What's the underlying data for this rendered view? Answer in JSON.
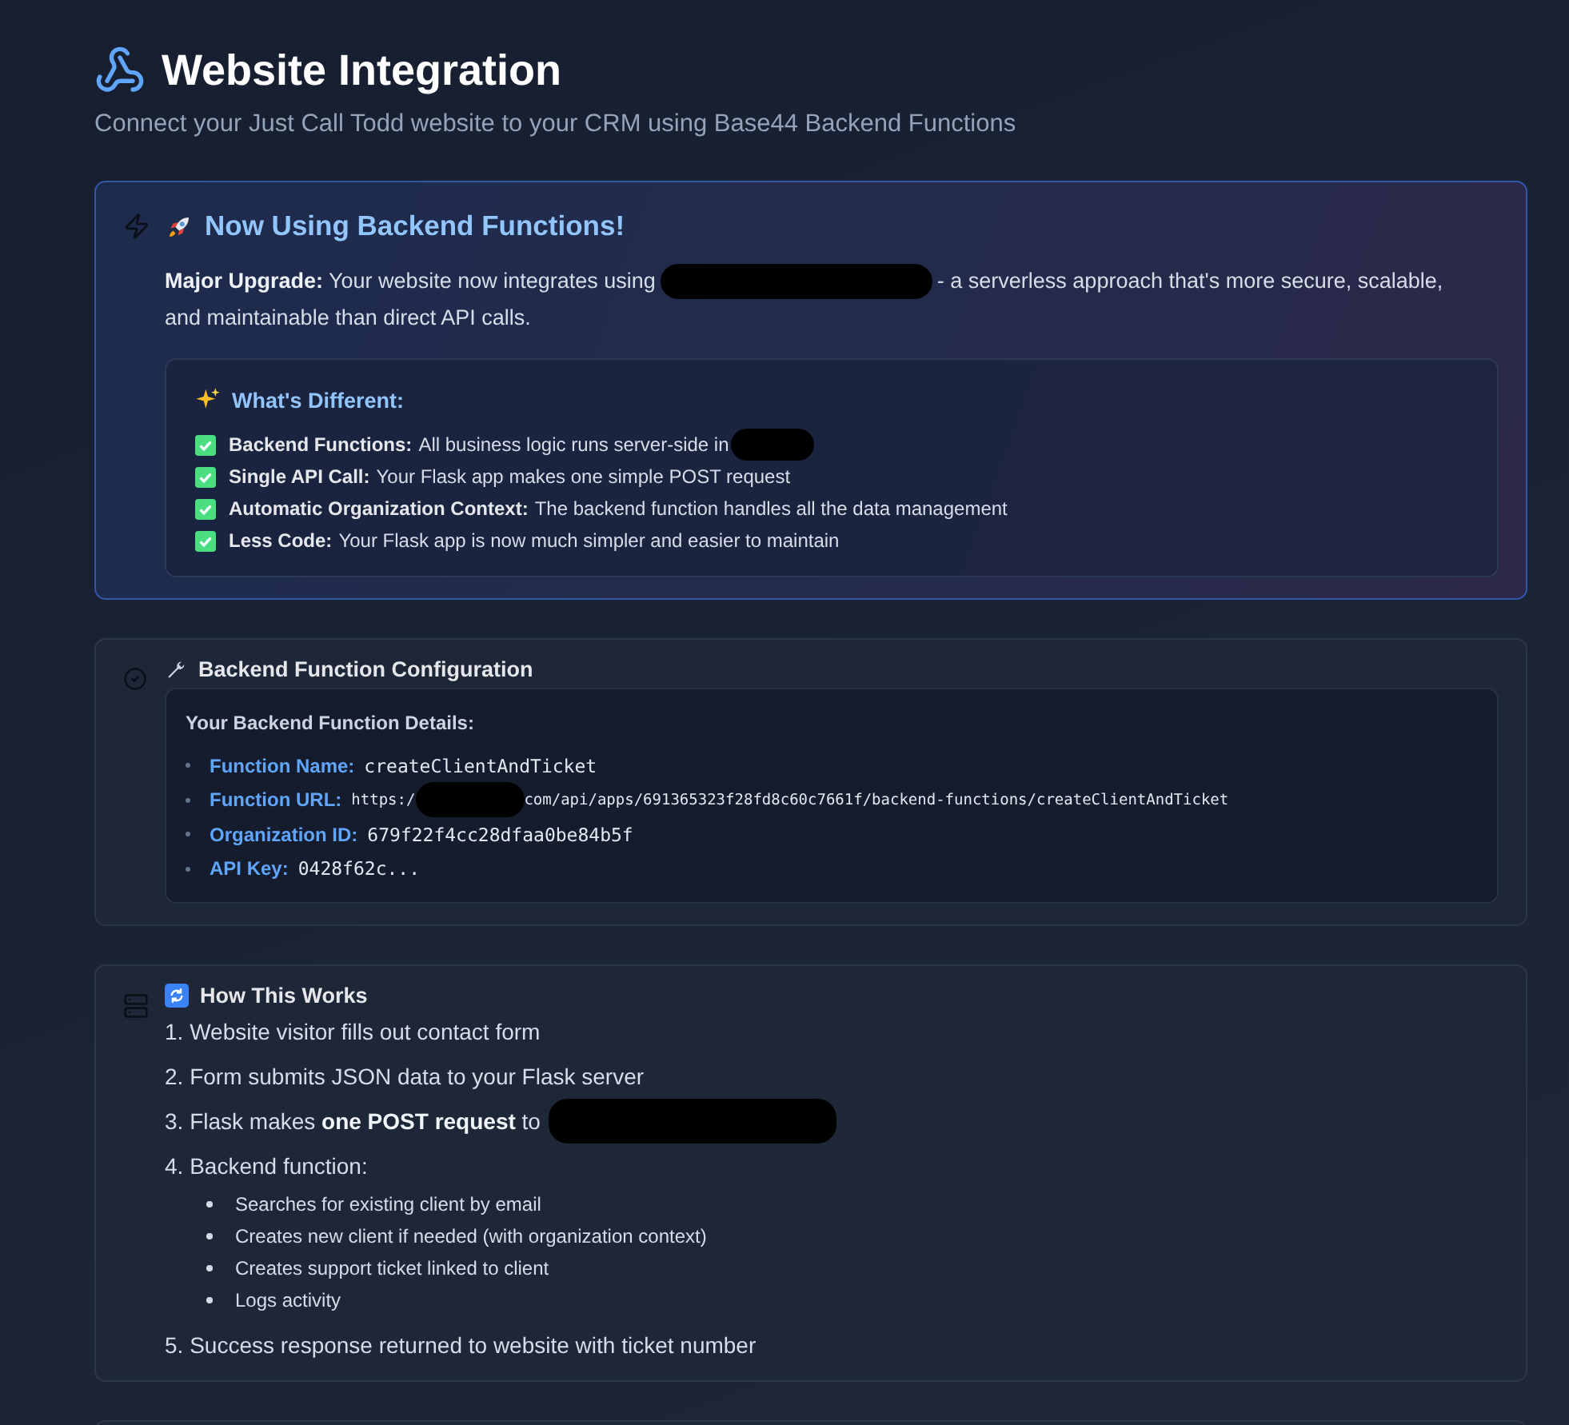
{
  "header": {
    "title": "Website Integration",
    "subtitle": "Connect your Just Call Todd website to your CRM using Base44 Backend Functions"
  },
  "upgrade_card": {
    "title": "Now Using Backend Functions!",
    "body": [
      [
        {
          "kind": "text",
          "text": "**Major Upgrade:** Your website now integrates using"
        },
        {
          "kind": "redaction"
        },
        {
          "kind": "text",
          "text": "- a serverless approach that's more secure, scalable,"
        }
      ],
      [
        {
          "kind": "text",
          "text": "and maintainable than direct API calls."
        }
      ]
    ],
    "differences_title": "What's Different:",
    "differences": [
      {
        "label": "Backend Functions:",
        "parts": [
          {
            "kind": "text",
            "text": "All business logic runs server-side in"
          },
          {
            "kind": "redaction"
          }
        ]
      },
      {
        "label": "Single API Call:",
        "parts": [
          {
            "kind": "text",
            "text": "Your Flask app makes one simple POST request"
          }
        ]
      },
      {
        "label": "Automatic Organization Context:",
        "parts": [
          {
            "kind": "text",
            "text": "The backend function handles all the data management"
          }
        ]
      },
      {
        "label": "Less Code:",
        "parts": [
          {
            "kind": "text",
            "text": "Your Flask app is now much simpler and easier to maintain"
          }
        ]
      }
    ]
  },
  "config_card": {
    "title": "Backend Function Configuration",
    "details_title": "Your Backend Function Details:",
    "details": [
      {
        "label": "Function Name:",
        "parts": [
          {
            "kind": "text",
            "text": "createClientAndTicket"
          }
        ],
        "kind": "value"
      },
      {
        "label": "Function URL:",
        "parts": [
          {
            "kind": "text",
            "text": "https:/"
          },
          {
            "kind": "redaction"
          },
          {
            "kind": "text",
            "text": "com/api/apps/691365323f28fd8c60c7661f/backend-functions/createClientAndTicket"
          }
        ],
        "kind": "url"
      },
      {
        "label": "Organization ID:",
        "parts": [
          {
            "kind": "text",
            "text": "679f22f4cc28dfaa0be84b5f"
          }
        ],
        "kind": "value"
      },
      {
        "label": "API Key:",
        "parts": [
          {
            "kind": "text",
            "text": "0428f62c..."
          }
        ],
        "kind": "value"
      }
    ]
  },
  "how_card": {
    "title": "How This Works",
    "steps": [
      {
        "parts": [
          {
            "kind": "text",
            "text": "1. Website visitor fills out contact form"
          }
        ]
      },
      {
        "parts": [
          {
            "kind": "text",
            "text": "2. Form submits JSON data to your Flask server"
          }
        ]
      },
      {
        "parts": [
          {
            "kind": "text",
            "text": "3. Flask makes **one POST request** to"
          },
          {
            "kind": "redaction"
          }
        ]
      },
      {
        "parts": [
          {
            "kind": "text",
            "text": "4. Backend function:"
          }
        ],
        "children": [
          "Searches for existing client by email",
          "Creates new client if needed (with organization context)",
          "Creates support ticket linked to client",
          "Logs activity"
        ]
      },
      {
        "parts": [
          {
            "kind": "text",
            "text": "5. Success response returned to website with ticket number"
          }
        ]
      }
    ]
  }
}
